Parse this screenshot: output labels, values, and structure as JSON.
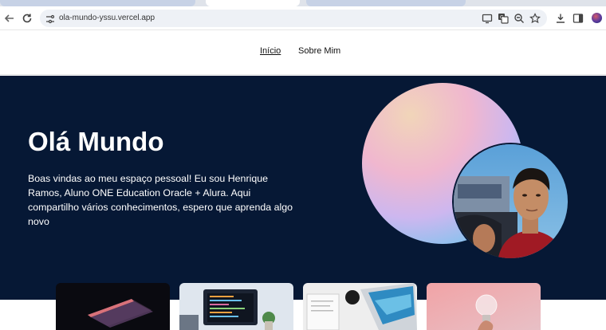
{
  "browser": {
    "url": "ola-mundo-yssu.vercel.app",
    "icons": [
      "back-arrow-icon",
      "reload-icon",
      "site-settings-icon",
      "cast-icon",
      "translate-icon",
      "zoom-icon",
      "bookmark-star-icon",
      "download-icon",
      "side-panel-icon",
      "profile-avatar"
    ]
  },
  "nav": {
    "links": [
      {
        "label": "Início",
        "active": true
      },
      {
        "label": "Sobre Mim",
        "active": false
      }
    ]
  },
  "hero": {
    "title": "Olá Mundo",
    "text": "Boas vindas ao meu espaço pessoal! Eu sou Henrique Ramos, Aluno ONE Education Oracle + Alura. Aqui compartilho vários conhecimentos, espero que aprenda algo novo"
  },
  "cards": [
    {
      "image": "laptop-dark"
    },
    {
      "image": "code-monitor"
    },
    {
      "image": "desk-laptop"
    },
    {
      "image": "lightbulb"
    }
  ],
  "colors": {
    "hero_background": "#061835",
    "accent_gradient": [
      "#f1d5b9",
      "#f0b7cf",
      "#cdb7ef",
      "#5fb6ee"
    ]
  }
}
